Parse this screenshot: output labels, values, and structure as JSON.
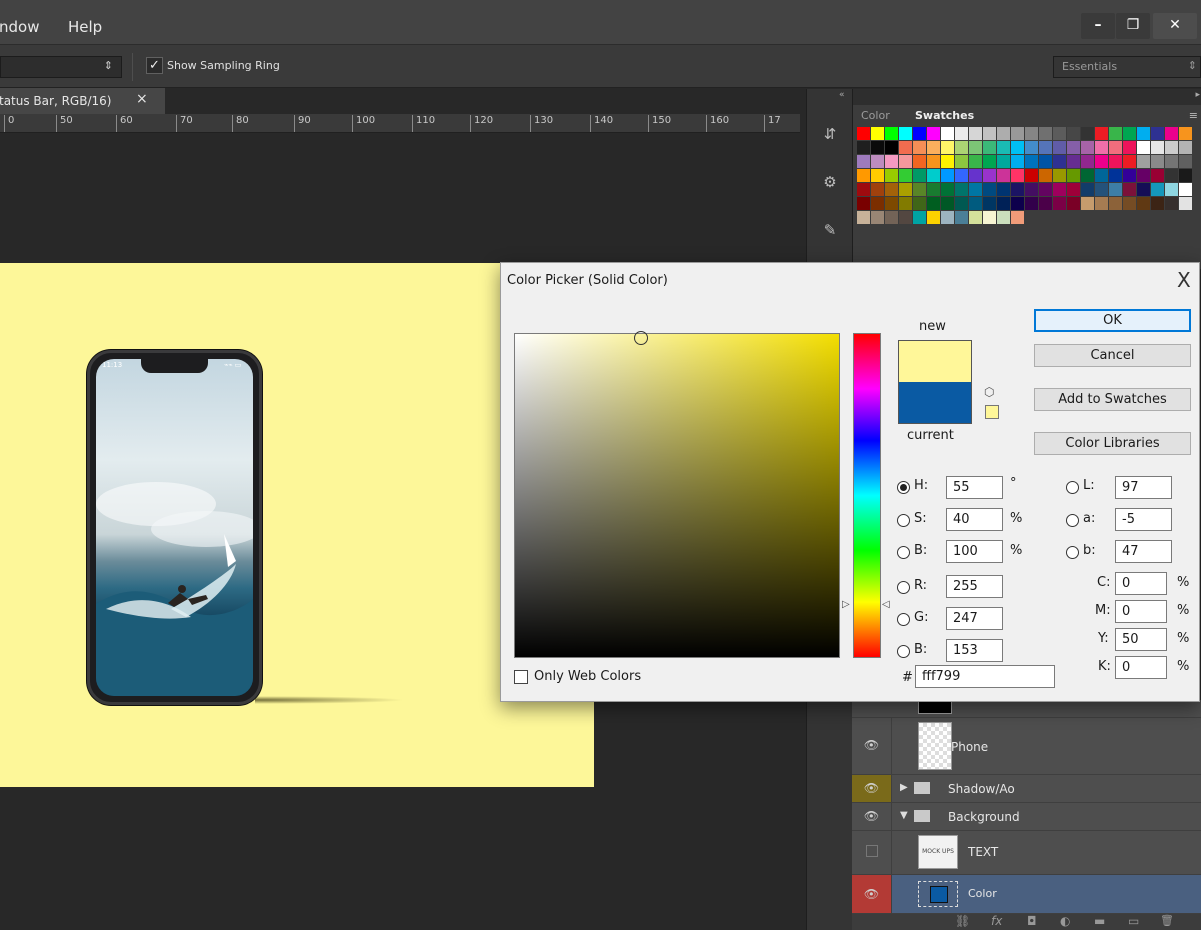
{
  "menu": {
    "items": [
      "ndow",
      "Help"
    ]
  },
  "window_controls": {
    "minimize": "–",
    "restore": "❐",
    "close": "✕"
  },
  "options": {
    "sample_select_arrow": "⇕",
    "show_sampling_ring_label": "Show Sampling Ring",
    "show_sampling_ring_checked": true,
    "workspace": "Essentials",
    "workspace_arrow": "⇕"
  },
  "document": {
    "tab_title": "tatus Bar, RGB/16)",
    "tab_close": "×"
  },
  "ruler": {
    "labels": [
      "0",
      "50",
      "60",
      "70",
      "80",
      "90",
      "100",
      "110",
      "120",
      "130",
      "140",
      "150",
      "160",
      "17"
    ]
  },
  "phone": {
    "status_time": "11:13",
    "status_icons": "⌁⌁ ▭"
  },
  "panel": {
    "collapse_left": "«",
    "collapse_right": "▸",
    "tabs": [
      "Color",
      "Swatches"
    ],
    "active_tab": "Swatches",
    "menu_icon": "≡"
  },
  "swatches": [
    "#ff0000",
    "#ffff00",
    "#00ff00",
    "#00ffff",
    "#0000ff",
    "#ff00ff",
    "#ffffff",
    "#ebebeb",
    "#d6d6d6",
    "#c2c2c2",
    "#adadad",
    "#999999",
    "#858585",
    "#707070",
    "#5c5c5c",
    "#474747",
    "#333333",
    "#ed1c24",
    "#39b54a",
    "#00a651",
    "#00aeef",
    "#2e3192",
    "#ec008c",
    "#f7941d",
    "#1f1f1f",
    "#0a0a0a",
    "#000000",
    "#f26c4f",
    "#f68e56",
    "#fbaf5d",
    "#fff568",
    "#acd373",
    "#7cc576",
    "#3bb878",
    "#1abbb4",
    "#00bff3",
    "#438ccb",
    "#5574b9",
    "#605ca8",
    "#855fa8",
    "#a763a8",
    "#f06ea9",
    "#f26d7d",
    "#ed145b",
    "#ffffff",
    "#e6e6e6",
    "#cccccc",
    "#b3b3b3",
    "#9e7bbd",
    "#bd8cbf",
    "#f49ac1",
    "#f5989d",
    "#f26522",
    "#f7941d",
    "#fff200",
    "#8dc63f",
    "#39b54a",
    "#00a651",
    "#00a99d",
    "#00aeef",
    "#0072bc",
    "#0054a6",
    "#2e3192",
    "#662d91",
    "#92278f",
    "#ec008c",
    "#ed145b",
    "#ed1c24",
    "#a0a0a0",
    "#8a8a8a",
    "#757575",
    "#606060",
    "#ff9900",
    "#ffcc00",
    "#99cc00",
    "#33cc33",
    "#009966",
    "#00cccc",
    "#0099ff",
    "#3366ff",
    "#6633cc",
    "#9933cc",
    "#cc3399",
    "#ff3366",
    "#cc0000",
    "#cc6600",
    "#999900",
    "#669900",
    "#006633",
    "#006699",
    "#003399",
    "#330099",
    "#660066",
    "#990033",
    "#333333",
    "#1a1a1a",
    "#9e0b0f",
    "#a0410d",
    "#a36209",
    "#aba000",
    "#598527",
    "#197b30",
    "#007236",
    "#00746b",
    "#0076a3",
    "#004a80",
    "#003471",
    "#1b1464",
    "#440e62",
    "#630460",
    "#9e005d",
    "#9e0039",
    "#123c69",
    "#24527a",
    "#3d7ea6",
    "#7b113a",
    "#150e56",
    "#1597bb",
    "#8fd6e1",
    "#ffffff",
    "#790000",
    "#7b2e00",
    "#7d4900",
    "#827b00",
    "#406618",
    "#005e20",
    "#005826",
    "#005952",
    "#005b7f",
    "#003663",
    "#002157",
    "#0d004c",
    "#32004b",
    "#4b0049",
    "#7b0046",
    "#7a0026",
    "#c69c6d",
    "#a67c52",
    "#8c6239",
    "#754c24",
    "#603913",
    "#3c2415",
    "#362f2d",
    "#e3e3e3",
    "#c7b299",
    "#998675",
    "#736357",
    "#534741",
    "#00a3a3",
    "#fcd200",
    "#9db4c0",
    "#4b7f97",
    "#d4e09b",
    "#f6f4d2",
    "#cbdfbd",
    "#f19c79"
  ],
  "layers": [
    {
      "name": "",
      "visible": true,
      "type": "fill"
    },
    {
      "name": "Phone",
      "visible": true,
      "type": "smart"
    },
    {
      "name": "Shadow/Ao",
      "visible": true,
      "type": "group",
      "expanded": false
    },
    {
      "name": "Background",
      "visible": true,
      "type": "group",
      "expanded": true
    },
    {
      "name": "TEXT",
      "visible": false,
      "type": "smart",
      "thumb_text": "MOCK UPS"
    },
    {
      "name": "Color",
      "visible": true,
      "type": "fill",
      "selected": true
    }
  ],
  "layer_footer_icons": [
    "⛓",
    "fx",
    "◘",
    "◐",
    "▬",
    "▭",
    "🗑"
  ],
  "layer_expand_glyphs": {
    "collapsed": "▶",
    "expanded": "▼"
  },
  "dialog": {
    "title": "Color Picker (Solid Color)",
    "close": "X",
    "new_label": "new",
    "current_label": "current",
    "new_color": "#fff799",
    "current_color": "#0a5aa3",
    "buttons": {
      "ok": "OK",
      "cancel": "Cancel",
      "add_to_swatches": "Add to Swatches",
      "color_libraries": "Color Libraries"
    },
    "hsb": [
      {
        "label": "H:",
        "value": "55",
        "unit": "°",
        "selected": true
      },
      {
        "label": "S:",
        "value": "40",
        "unit": "%",
        "selected": false
      },
      {
        "label": "B:",
        "value": "100",
        "unit": "%",
        "selected": false
      }
    ],
    "rgb": [
      {
        "label": "R:",
        "value": "255"
      },
      {
        "label": "G:",
        "value": "247"
      },
      {
        "label": "B:",
        "value": "153"
      }
    ],
    "lab": [
      {
        "label": "L:",
        "value": "97"
      },
      {
        "label": "a:",
        "value": "-5"
      },
      {
        "label": "b:",
        "value": "47"
      }
    ],
    "cmyk": [
      {
        "label": "C:",
        "value": "0",
        "unit": "%"
      },
      {
        "label": "M:",
        "value": "0",
        "unit": "%"
      },
      {
        "label": "Y:",
        "value": "50",
        "unit": "%"
      },
      {
        "label": "K:",
        "value": "0",
        "unit": "%"
      }
    ],
    "hex_label": "#",
    "hex": "fff799",
    "only_web_colors": "Only Web Colors",
    "hue_marker_left": "▷",
    "hue_marker_right": "◁"
  },
  "colors": {
    "canvas_bg": "#fdf799",
    "app_bg": "#282828",
    "dialog_bg": "#f0f0f0",
    "selected_layer": "#4a6080",
    "close_red": "#c4302b"
  }
}
